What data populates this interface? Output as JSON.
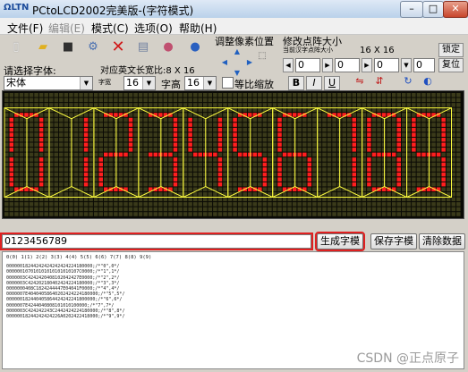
{
  "window": {
    "title": "PCtoLCD2002完美版-(字符模式)",
    "icon_text": "ΩLTN",
    "buttons": [
      "–",
      "□",
      "✕"
    ]
  },
  "menu": [
    {
      "label": "文件(F)",
      "disabled": false
    },
    {
      "label": "编辑(E)",
      "disabled": true
    },
    {
      "label": "模式(C)",
      "disabled": false
    },
    {
      "label": "选项(O)",
      "disabled": false
    },
    {
      "label": "帮助(H)",
      "disabled": false
    }
  ],
  "toolbar": {
    "font_select_label": "请选择字体:",
    "font_value": "宋体",
    "width_caption": "字宽",
    "width_value": "16",
    "height_caption": "字高",
    "height_value": "16",
    "proportional_label": "等比缩放",
    "ascii_size_label": "对应英文长宽比:8 X 16",
    "pixel_pos_label": "调整像素位置",
    "dot_size_label": "修改点阵大小",
    "current_size_caption": "当前汉字点阵大小",
    "current_size_value": "16 X 16",
    "lock_label": "锁定",
    "reset_label": "复位",
    "spin_values": [
      "0",
      "0",
      "0",
      "0"
    ],
    "format_bold": "B",
    "format_italic": "I",
    "format_underline": "U"
  },
  "matrix": {
    "characters": "0123456789",
    "cell_color": "#3a3a1a",
    "lit_color": "#ff1e1e",
    "grid_color": "#6a6a2a",
    "guide_color": "#ffff40"
  },
  "input": {
    "value": "0123456789"
  },
  "actions": {
    "generate": "生成字模",
    "save": "保存字模",
    "clear": "清除数据"
  },
  "output": {
    "header": "0(0) 1(1) 2(2) 3(3) 4(4) 5(5) 6(6) 7(7) 8(8) 9(9)",
    "lines": [
      "00000018244242424242424224180000;/*\"0\",0*/",
      "000000107010101010101010107C0000;/*\"1\",1*/",
      "0000003C4242420408102042427E0000;/*\"2\",2*/",
      "0000003C424202180402424224180000;/*\"3\",3*/",
      "0000000408C1824244447E04041F0000;/*\"4\",4*/",
      "0000007E40404058640202424224180000;/*\"5\",5*/",
      "000000182440405864424242241800000;/*\"6\",6*/",
      "0000007E4244040808101010100000;/*\"7\",7*/",
      "0000003C424242243C2442424224180000;/*\"8\",8*/",
      "00000018244242424226A0202422418000;/*\"9\",9*/"
    ]
  },
  "watermark": "CSDN @正点原子"
}
